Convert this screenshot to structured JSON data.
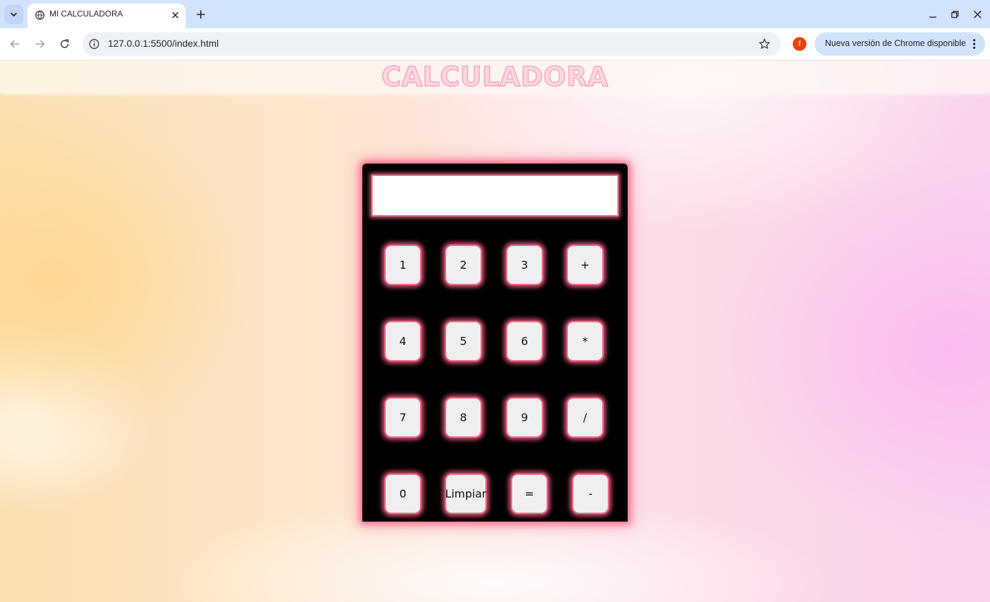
{
  "browser": {
    "tab_title": "MI CALCULADORA",
    "url": "127.0.0.1:5500/index.html",
    "profile_initial": "f",
    "update_label": "Nueva versión de Chrome disponible",
    "accent_color": "#d3e3fd"
  },
  "page": {
    "title": "CALCULADORA",
    "title_color": "#fcd7e2"
  },
  "calculator": {
    "display_value": "",
    "glow_color": "#f06a8a",
    "keys": {
      "k1": "1",
      "k2": "2",
      "k3": "3",
      "plus": "+",
      "k4": "4",
      "k5": "5",
      "k6": "6",
      "multiply": "*",
      "k7": "7",
      "k8": "8",
      "k9": "9",
      "divide": "/",
      "k0": "0",
      "clear": "Limpiar",
      "equals": "=",
      "minus": "-"
    }
  }
}
